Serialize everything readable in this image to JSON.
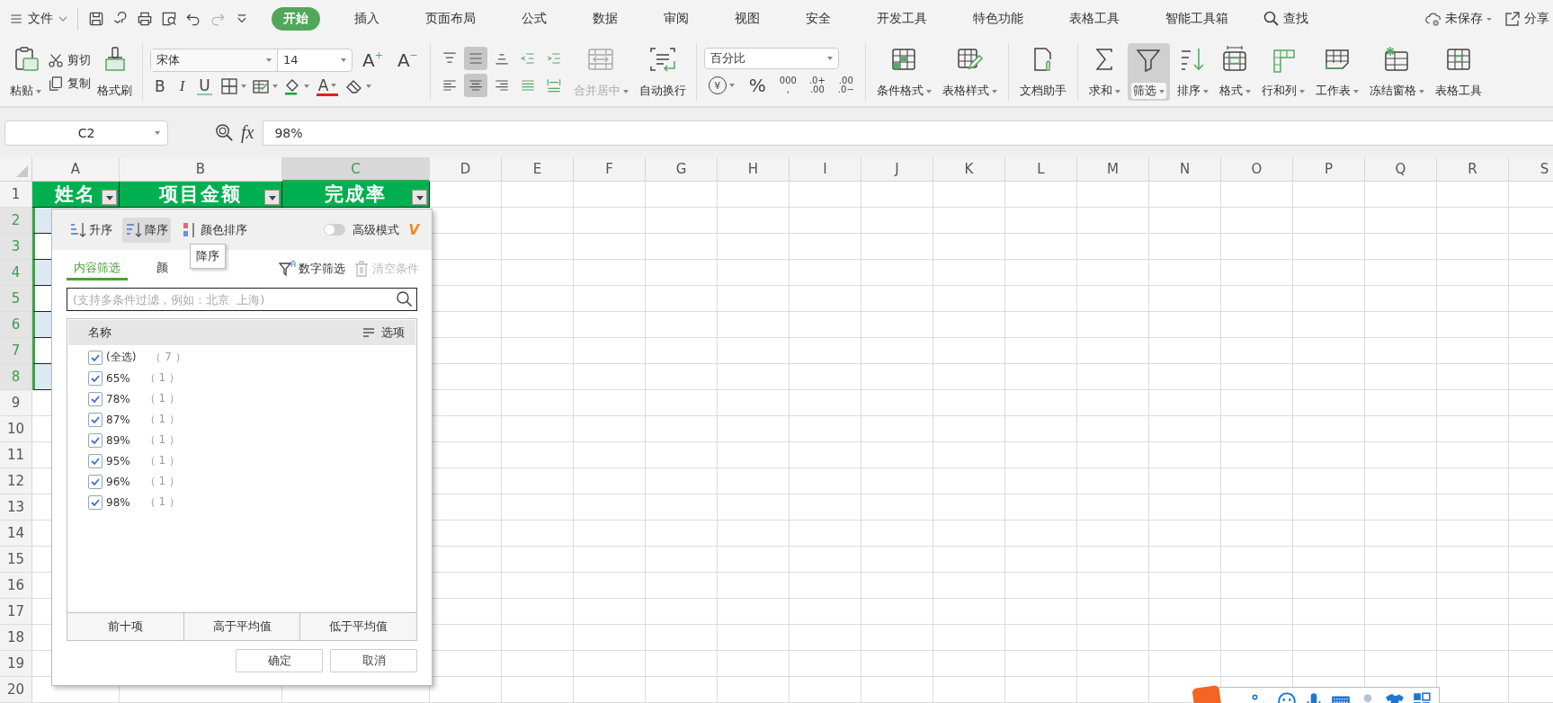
{
  "menu_bar": {
    "file": "文件",
    "quick_access": [
      {
        "disabled": false
      },
      {
        "disabled": false
      },
      {
        "disabled": false
      },
      {
        "disabled": false
      },
      {
        "disabled": false
      },
      {
        "disabled": true
      },
      {
        "disabled": false
      }
    ],
    "tabs": [
      {
        "label": "开始",
        "selected": true
      },
      {
        "label": "插入",
        "selected": false
      },
      {
        "label": "页面布局",
        "selected": false
      },
      {
        "label": "公式",
        "selected": false
      },
      {
        "label": "数据",
        "selected": false
      },
      {
        "label": "审阅",
        "selected": false
      },
      {
        "label": "视图",
        "selected": false
      },
      {
        "label": "安全",
        "selected": false
      },
      {
        "label": "开发工具",
        "selected": false
      },
      {
        "label": "特色功能",
        "selected": false
      },
      {
        "label": "表格工具",
        "selected": false
      },
      {
        "label": "智能工具箱",
        "selected": false
      }
    ],
    "search": "查找",
    "save_status": "未保存",
    "share": "分享"
  },
  "ribbon": {
    "clipboard": {
      "paste": "粘贴",
      "cut": "剪切",
      "copy": "复制",
      "format_painter": "格式刷"
    },
    "font": {
      "name": "宋体",
      "size": "14",
      "grow": {
        "letter": "A",
        "sign": "+"
      },
      "shrink": {
        "letter": "A",
        "sign": "−"
      },
      "bold": "B",
      "italic": "I",
      "underline": "U",
      "font_color_glyph": "A"
    },
    "alignment": {
      "rows": [
        [
          {
            "selected": false
          },
          {
            "selected": true
          },
          {
            "selected": false
          },
          {
            "selected": false
          },
          {
            "selected": false
          }
        ],
        [
          {
            "selected": false
          },
          {
            "selected": true
          },
          {
            "selected": false
          },
          {
            "selected": false
          },
          {
            "selected": false
          }
        ]
      ],
      "merge": {
        "label": "合并居中",
        "disabled": true
      },
      "wrap": {
        "label": "自动换行",
        "disabled": false
      }
    },
    "number": {
      "format": "百分比",
      "currency": "¥",
      "percent": "%",
      "thousands": [
        "000",
        ","
      ],
      "decimal_up": [
        ".0+",
        ".00"
      ],
      "decimal_down": [
        ".00",
        ".0−"
      ]
    },
    "tool_groups": [
      [
        {
          "label": "条件格式",
          "dropdown": true,
          "selected": false
        },
        {
          "label": "表格样式",
          "dropdown": true,
          "selected": false
        }
      ],
      [
        {
          "label": "文档助手",
          "dropdown": false,
          "selected": false
        }
      ],
      [
        {
          "label": "求和",
          "dropdown": true,
          "selected": false
        },
        {
          "label": "筛选",
          "dropdown": true,
          "selected": true
        },
        {
          "label": "排序",
          "dropdown": true,
          "selected": false
        },
        {
          "label": "格式",
          "dropdown": true,
          "selected": false
        },
        {
          "label": "行和列",
          "dropdown": true,
          "selected": false
        },
        {
          "label": "工作表",
          "dropdown": true,
          "selected": false
        },
        {
          "label": "冻结窗格",
          "dropdown": true,
          "selected": false
        },
        {
          "label": "表格工具",
          "dropdown": false,
          "selected": false
        }
      ]
    ]
  },
  "formula_bar": {
    "name_box": "C2",
    "fx": "fx",
    "value": "98%"
  },
  "sheet": {
    "columns": [
      {
        "letter": "A",
        "selected": false
      },
      {
        "letter": "B",
        "selected": false
      },
      {
        "letter": "C",
        "selected": true
      },
      {
        "letter": "D",
        "selected": false
      },
      {
        "letter": "E",
        "selected": false
      },
      {
        "letter": "F",
        "selected": false
      },
      {
        "letter": "G",
        "selected": false
      },
      {
        "letter": "H",
        "selected": false
      },
      {
        "letter": "I",
        "selected": false
      },
      {
        "letter": "J",
        "selected": false
      },
      {
        "letter": "K",
        "selected": false
      },
      {
        "letter": "L",
        "selected": false
      },
      {
        "letter": "M",
        "selected": false
      },
      {
        "letter": "N",
        "selected": false
      },
      {
        "letter": "O",
        "selected": false
      },
      {
        "letter": "P",
        "selected": false
      },
      {
        "letter": "Q",
        "selected": false
      },
      {
        "letter": "R",
        "selected": false
      },
      {
        "letter": "S",
        "selected": false
      }
    ],
    "rows": [
      {
        "number": "1",
        "selected": false
      },
      {
        "number": "2",
        "selected": true,
        "banded": true
      },
      {
        "number": "3",
        "selected": true,
        "banded": false
      },
      {
        "number": "4",
        "selected": true,
        "banded": true
      },
      {
        "number": "5",
        "selected": true,
        "banded": false
      },
      {
        "number": "6",
        "selected": true,
        "banded": true
      },
      {
        "number": "7",
        "selected": true,
        "banded": false
      },
      {
        "number": "8",
        "selected": true,
        "banded": true
      },
      {
        "number": "9",
        "selected": false
      },
      {
        "number": "10",
        "selected": false
      },
      {
        "number": "11",
        "selected": false
      },
      {
        "number": "12",
        "selected": false
      },
      {
        "number": "13",
        "selected": false
      },
      {
        "number": "14",
        "selected": false
      },
      {
        "number": "15",
        "selected": false
      },
      {
        "number": "16",
        "selected": false
      },
      {
        "number": "17",
        "selected": false
      },
      {
        "number": "18",
        "selected": false
      },
      {
        "number": "19",
        "selected": false
      },
      {
        "number": "20",
        "selected": false
      }
    ],
    "header_cells": [
      {
        "text": "姓名"
      },
      {
        "text": "项目金额"
      },
      {
        "text": "完成率"
      }
    ]
  },
  "filter_panel": {
    "sort": [
      {
        "label": "升序",
        "selected": false
      },
      {
        "label": "降序",
        "selected": true
      },
      {
        "label": "颜色排序",
        "selected": false
      }
    ],
    "advanced": {
      "label": "高级模式",
      "on": false
    },
    "vip": "V",
    "tooltip": "降序",
    "tabs": [
      {
        "label": "内容筛选",
        "selected": true
      },
      {
        "label": "颜",
        "selected": false
      }
    ],
    "number_filter": {
      "label": "数字筛选",
      "disabled": false
    },
    "clear": {
      "label": "清空条件",
      "disabled": true
    },
    "search": {
      "placeholder": "(支持多条件过滤，例如：北京  上海)"
    },
    "list_header": "名称",
    "options": "选项",
    "items": [
      {
        "label": "(全选)",
        "count": "（ 7 ）",
        "checked": true
      },
      {
        "label": "65%",
        "count": "（ 1 ）",
        "checked": true
      },
      {
        "label": "78%",
        "count": "（ 1 ）",
        "checked": true
      },
      {
        "label": "87%",
        "count": "（ 1 ）",
        "checked": true
      },
      {
        "label": "89%",
        "count": "（ 1 ）",
        "checked": true
      },
      {
        "label": "95%",
        "count": "（ 1 ）",
        "checked": true
      },
      {
        "label": "96%",
        "count": "（ 1 ）",
        "checked": true
      },
      {
        "label": "98%",
        "count": "（ 1 ）",
        "checked": true
      }
    ],
    "quick_filters": [
      "前十项",
      "高于平均值",
      "低于平均值"
    ],
    "buttons": [
      "确定",
      "取消"
    ]
  }
}
